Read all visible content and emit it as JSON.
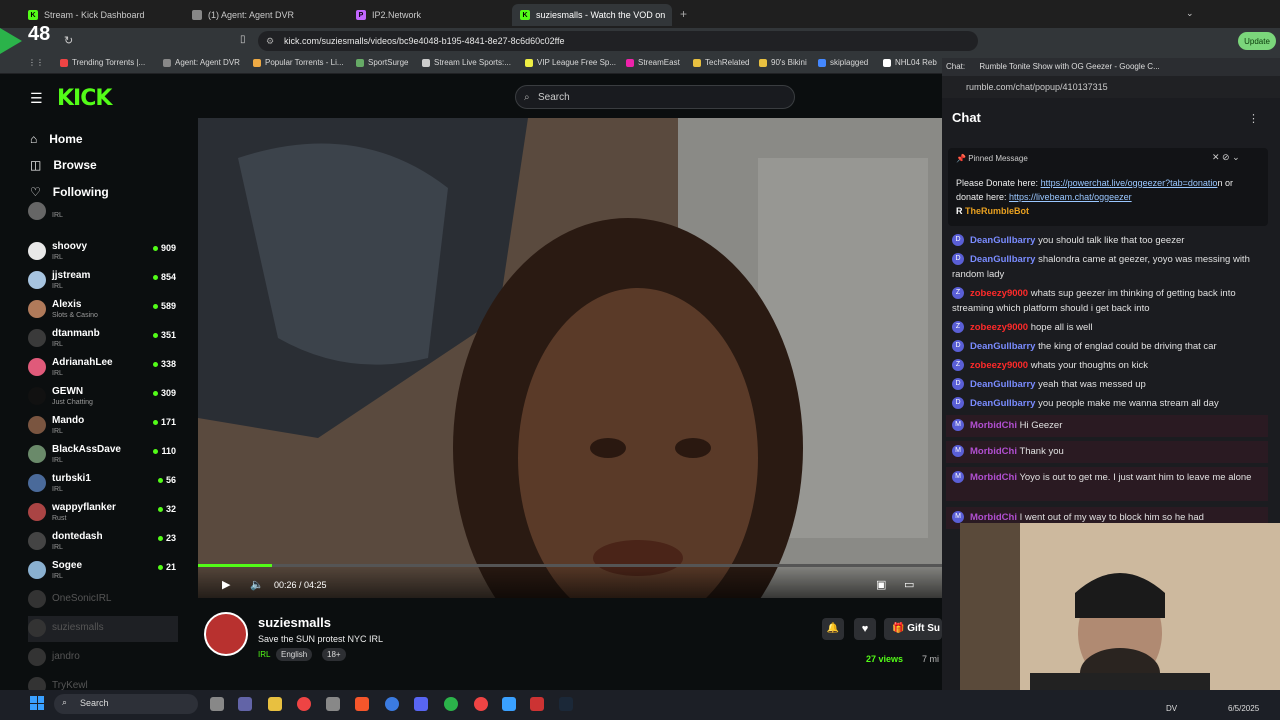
{
  "clock_overlay": "48",
  "browser": {
    "tabs": [
      {
        "label": "Stream - Kick Dashboard",
        "color": "#53fc18"
      },
      {
        "label": "(1) Agent: Agent DVR",
        "color": "#888888"
      },
      {
        "label": "IP2.Network",
        "color": "#c266ff"
      },
      {
        "label": "suziesmalls - Watch the VOD on",
        "color": "#53fc18"
      }
    ],
    "url": "kick.com/suziesmalls/videos/bc9e4048-b195-4841-8e27-8c6d60c02ffe",
    "update_label": "Update",
    "bookmarks": [
      "Trending Torrents |...",
      "Agent: Agent DVR",
      "Popular Torrents - Li...",
      "SportSurge",
      "Stream Live Sports:...",
      "VIP League Free Sp...",
      "StreamEast",
      "TechRelated",
      "90's Bikini",
      "skiplagged",
      "NHL04 Reb"
    ]
  },
  "kick": {
    "logo": "KICK",
    "search_placeholder": "Search",
    "nav": [
      "Home",
      "Browse",
      "Following"
    ],
    "channels": [
      {
        "name": "",
        "category": "IRL",
        "viewers": "",
        "color": "#666"
      },
      {
        "name": "shoovy",
        "category": "IRL",
        "viewers": "909",
        "color": "#e8e8e8"
      },
      {
        "name": "jjstream",
        "category": "IRL",
        "viewers": "854",
        "color": "#a7c4e0"
      },
      {
        "name": "Alexis",
        "category": "Slots & Casino",
        "viewers": "589",
        "color": "#b07a5a"
      },
      {
        "name": "dtanmanb",
        "category": "IRL",
        "viewers": "351",
        "color": "#3a3a3a"
      },
      {
        "name": "AdrianahLee",
        "category": "IRL",
        "viewers": "338",
        "color": "#e05a7a"
      },
      {
        "name": "GEWN",
        "category": "Just Chatting",
        "viewers": "309",
        "color": "#111111"
      },
      {
        "name": "Mando",
        "category": "IRL",
        "viewers": "171",
        "color": "#7a5540"
      },
      {
        "name": "BlackAssDave",
        "category": "IRL",
        "viewers": "110",
        "color": "#6a8a6a"
      },
      {
        "name": "turbski1",
        "category": "IRL",
        "viewers": "56",
        "color": "#4a6a9a"
      },
      {
        "name": "wappyflanker",
        "category": "Rust",
        "viewers": "32",
        "color": "#aa4444"
      },
      {
        "name": "dontedash",
        "category": "IRL",
        "viewers": "23",
        "color": "#444444"
      },
      {
        "name": "Sogee",
        "category": "IRL",
        "viewers": "21",
        "color": "#8ab0d0"
      }
    ],
    "offline": [
      "OneSonicIRL",
      "suziesmalls",
      "jandro",
      "TryKewl"
    ],
    "video": {
      "time": "00:26 / 04:25",
      "progress": 0.1
    },
    "streamer": {
      "name": "suziesmalls",
      "title": "Save the SUN protest NYC IRL",
      "tags": [
        "IRL",
        "English",
        "18+"
      ],
      "views": "27 views",
      "ago": "7 mi",
      "gift": "Gift Su"
    }
  },
  "chat": {
    "window_title": "Rumble Tonite Show with OG Geezer - Google C...",
    "window_label": "Chat:",
    "url": "rumble.com/chat/popup/410137315",
    "heading": "Chat",
    "pinned_label": "Pinned Message",
    "pinned_text_1": "Please Donate here: ",
    "pinned_link_1": "https://powerchat.live/oggeezer?tab=donatio",
    "pinned_text_2": "n or donate here: ",
    "pinned_link_2": "https://livebeam.chat/oggeezer",
    "pinned_user": "TheRumbleBot",
    "messages": [
      {
        "initial": "D",
        "user": "DeanGullbarry",
        "text": "you should talk like that too geezer",
        "cls": "u-dg"
      },
      {
        "initial": "D",
        "user": "DeanGullbarry",
        "text": "shalondra came at geezer, yoyo was messing with random lady",
        "cls": "u-dg"
      },
      {
        "initial": "Z",
        "user": "zobeezy9000",
        "text": "whats sup geezer im thinking of getting back into streaming which platform should i get back into",
        "cls": "u-zo"
      },
      {
        "initial": "Z",
        "user": "zobeezy9000",
        "text": "hope all is well",
        "cls": "u-zo"
      },
      {
        "initial": "D",
        "user": "DeanGullbarry",
        "text": "the king of englad could be driving that car",
        "cls": "u-dg"
      },
      {
        "initial": "Z",
        "user": "zobeezy9000",
        "text": "whats your thoughts on kick",
        "cls": "u-zo"
      },
      {
        "initial": "D",
        "user": "DeanGullbarry",
        "text": "yeah that was messed up",
        "cls": "u-dg"
      },
      {
        "initial": "D",
        "user": "DeanGullbarry",
        "text": "you people make me wanna stream all day",
        "cls": "u-dg"
      },
      {
        "initial": "M",
        "user": "MorbidChi",
        "text": "Hi Geezer",
        "cls": "u-mo"
      },
      {
        "initial": "M",
        "user": "MorbidChi",
        "text": "Thank you",
        "cls": "u-mo"
      },
      {
        "initial": "M",
        "user": "MorbidChi",
        "text": "Yoyo is out to get me. I just want him to leave me alone",
        "cls": "u-mo"
      },
      {
        "initial": "M",
        "user": "MorbidChi",
        "text": "I went out of my way to block him so he had",
        "cls": "u-mo"
      }
    ]
  },
  "taskbar": {
    "search": "Search",
    "date": "6/5/2025",
    "lang": "DV"
  }
}
